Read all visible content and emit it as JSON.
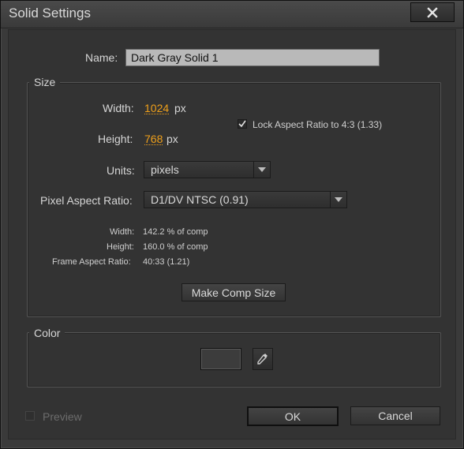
{
  "window": {
    "title": "Solid Settings"
  },
  "name_row": {
    "label": "Name:",
    "value": "Dark Gray Solid 1"
  },
  "size_group": {
    "title": "Size",
    "width_label": "Width:",
    "width_value": "1024",
    "width_unit": "px",
    "height_label": "Height:",
    "height_value": "768",
    "height_unit": "px",
    "lock_aspect_label": "Lock Aspect Ratio to 4:3 (1.33)",
    "lock_aspect_checked": true,
    "units_label": "Units:",
    "units_value": "pixels",
    "par_label": "Pixel Aspect Ratio:",
    "par_value": "D1/DV NTSC (0.91)",
    "info_width_label": "Width:",
    "info_width_value": "142.2 % of comp",
    "info_height_label": "Height:",
    "info_height_value": "160.0 % of comp",
    "info_far_label": "Frame Aspect Ratio:",
    "info_far_value": "40:33 (1.21)",
    "make_comp_size_label": "Make Comp Size"
  },
  "color_group": {
    "title": "Color",
    "swatch_color": "#3c3c3c"
  },
  "footer": {
    "preview_label": "Preview",
    "preview_checked": false,
    "ok_label": "OK",
    "cancel_label": "Cancel"
  },
  "colors": {
    "accent_value": "#f0a01a",
    "background": "#333333",
    "text": "#d6d6d6"
  }
}
